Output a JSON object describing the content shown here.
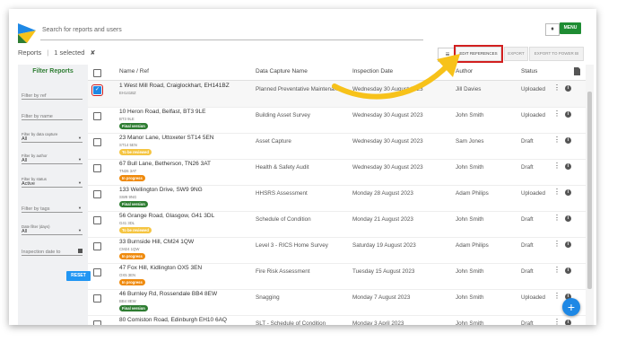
{
  "search": {
    "placeholder": "Search for reports and users"
  },
  "header": {
    "menu_label": "MENU"
  },
  "toolbar": {
    "reports_label": "Reports",
    "selected_count": "1",
    "selected_suffix": "selected",
    "edit_references_label": "EDIT REFERENCES",
    "export_label": "EXPORT",
    "export_powerbi_label": "EXPORT TO POWER BI"
  },
  "sidebar": {
    "title": "Filter Reports",
    "filter_by_ref": "Filter by ref",
    "filter_by_name": "Filter by name",
    "data_capture_label": "Filter by data capture",
    "data_capture_value": "All",
    "author_label": "Filter by author",
    "author_value": "All",
    "status_label": "Filter by status",
    "status_value": "Active",
    "tags_placeholder": "Filter by tags",
    "date_filter_label": "Date filter (days)",
    "date_filter_value": "All",
    "inspection_date_placeholder": "Inspection date to",
    "reset_label": "RESET"
  },
  "table": {
    "columns": {
      "name": "Name / Ref",
      "data_capture": "Data Capture Name",
      "inspection_date": "Inspection Date",
      "author": "Author",
      "status": "Status"
    },
    "rows": [
      {
        "address": "1 West Mill Road, Craiglockhart, EH141BZ",
        "postcode": "EH141BZ",
        "badge": "",
        "capture": "Planned Preventative Maintenance",
        "date": "Wednesday 30 August 2023",
        "author": "Jill Davies",
        "status": "Uploaded",
        "checked": true
      },
      {
        "address": "10 Heron Road, Belfast, BT3 9LE",
        "postcode": "BT3 9LE",
        "badge": "Final version",
        "capture": "Building Asset Survey",
        "date": "Wednesday 30 August 2023",
        "author": "John Smith",
        "status": "Uploaded",
        "checked": false
      },
      {
        "address": "23 Manor Lane, Uttoxeter ST14 5EN",
        "postcode": "ST14 5EN",
        "badge": "To be reviewed",
        "capture": "Asset Capture",
        "date": "Wednesday 30 August 2023",
        "author": "Sam Jones",
        "status": "Draft",
        "checked": false
      },
      {
        "address": "67 Bull Lane, Betherson, TN26 3AT",
        "postcode": "TN26 3AT",
        "badge": "In progress",
        "capture": "Health & Safety Audit",
        "date": "Wednesday 30 August 2023",
        "author": "John Smith",
        "status": "Draft",
        "checked": false
      },
      {
        "address": "133 Wellington Drive, SW9 9NG",
        "postcode": "SW9 9NG",
        "badge": "Final version",
        "capture": "HHSRS Assessment",
        "date": "Monday 28 August 2023",
        "author": "Adam Philips",
        "status": "Uploaded",
        "checked": false
      },
      {
        "address": "56 Grange Road, Glasgow, G41 3DL",
        "postcode": "G41 3DL",
        "badge": "To be reviewed",
        "capture": "Schedule of Condition",
        "date": "Monday 21 August 2023",
        "author": "John Smith",
        "status": "Draft",
        "checked": false
      },
      {
        "address": "33 Burnside Hill, CM24 1QW",
        "postcode": "CM24 1QW",
        "badge": "In progress",
        "capture": "Level 3 - RICS Home Survey",
        "date": "Saturday 19 August 2023",
        "author": "Adam Philips",
        "status": "Draft",
        "checked": false
      },
      {
        "address": "47 Fox Hill, Kidlington OX5 3EN",
        "postcode": "OX5 3EN",
        "badge": "In progress",
        "capture": "Fire Risk Assessment",
        "date": "Tuesday 15 August 2023",
        "author": "John Smith",
        "status": "Draft",
        "checked": false
      },
      {
        "address": "46 Burnley Rd, Rossendale BB4 8EW",
        "postcode": "BB4 8EW",
        "badge": "Final version",
        "capture": "Snagging",
        "date": "Monday 7 August 2023",
        "author": "John Smith",
        "status": "Uploaded",
        "checked": false
      },
      {
        "address": "80 Comiston Road, Edinburgh EH10 6AQ",
        "postcode": "EH10 6AQ",
        "badge": "",
        "capture": "SLT - Schedule of Condition",
        "date": "Monday 3 April 2023",
        "author": "John Smith",
        "status": "Draft",
        "checked": false
      }
    ]
  },
  "badge_colors": {
    "Final version": "#2e7d32",
    "To be reviewed": "#f5c542",
    "In progress": "#ef8a0c"
  },
  "colors": {
    "accent": "#1e88e5",
    "brand_green": "#1e8c33",
    "highlight_red": "#d21f1f",
    "arrow_yellow": "#f7c21a"
  }
}
